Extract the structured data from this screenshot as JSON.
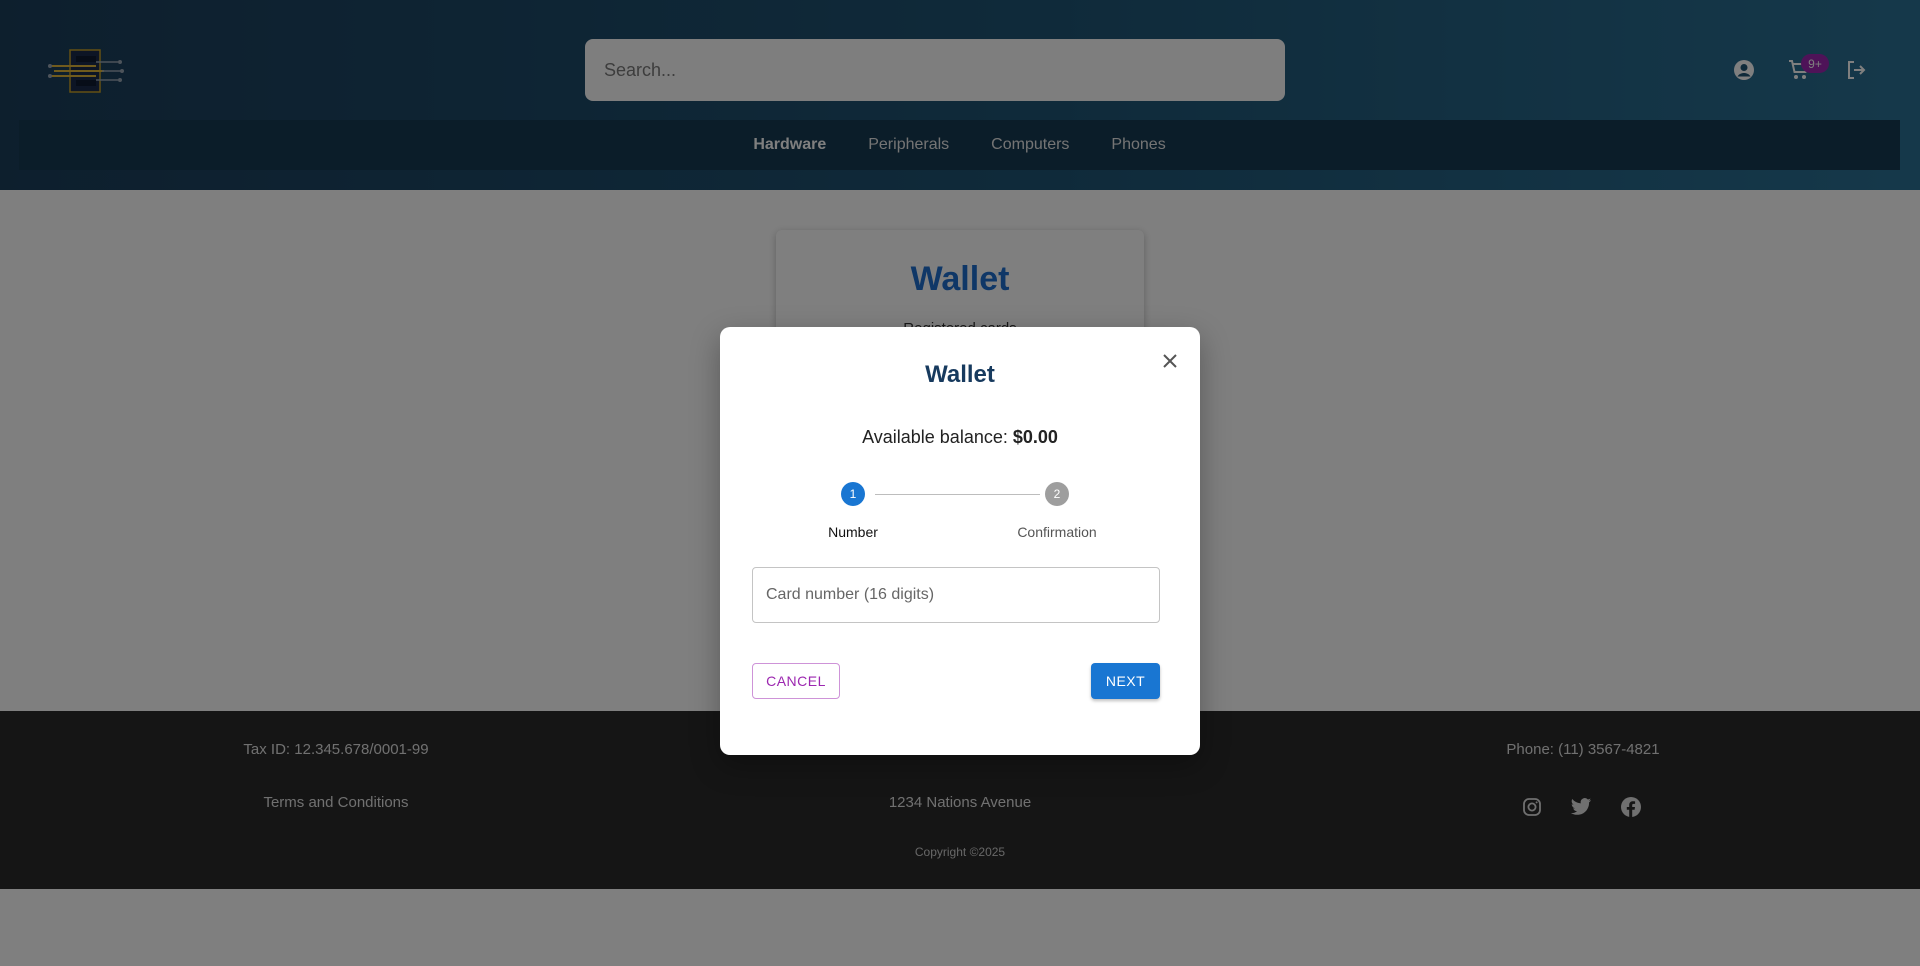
{
  "header": {
    "search_placeholder": "Search...",
    "cart_badge": "9+",
    "nav": [
      {
        "label": "Hardware",
        "active": true
      },
      {
        "label": "Peripherals",
        "active": false
      },
      {
        "label": "Computers",
        "active": false
      },
      {
        "label": "Phones",
        "active": false
      }
    ]
  },
  "background_card": {
    "title": "Wallet",
    "subtitle": "Registered cards"
  },
  "footer": {
    "tax_id": "Tax ID: 12.345.678/0001-99",
    "terms": "Terms and Conditions",
    "address": "1234 Nations Avenue",
    "phone": "Phone: (11) 3567-4821",
    "copyright": "Copyright ©2025"
  },
  "modal": {
    "title": "Wallet",
    "balance_label": "Available balance:",
    "balance_value": "$0.00",
    "steps": [
      {
        "number": "1",
        "label": "Number",
        "active": true
      },
      {
        "number": "2",
        "label": "Confirmation",
        "active": false
      }
    ],
    "card_input_placeholder": "Card number (16 digits)",
    "card_input_value": "",
    "cancel_label": "CANCEL",
    "next_label": "NEXT"
  },
  "colors": {
    "primary": "#1976d2",
    "secondary": "#9c27b0",
    "title": "#173a5e",
    "footer_bg": "#2a2a2a"
  },
  "icons": [
    "logo-icon",
    "account-icon",
    "cart-icon",
    "logout-icon",
    "close-icon",
    "instagram-icon",
    "twitter-icon",
    "facebook-icon"
  ]
}
